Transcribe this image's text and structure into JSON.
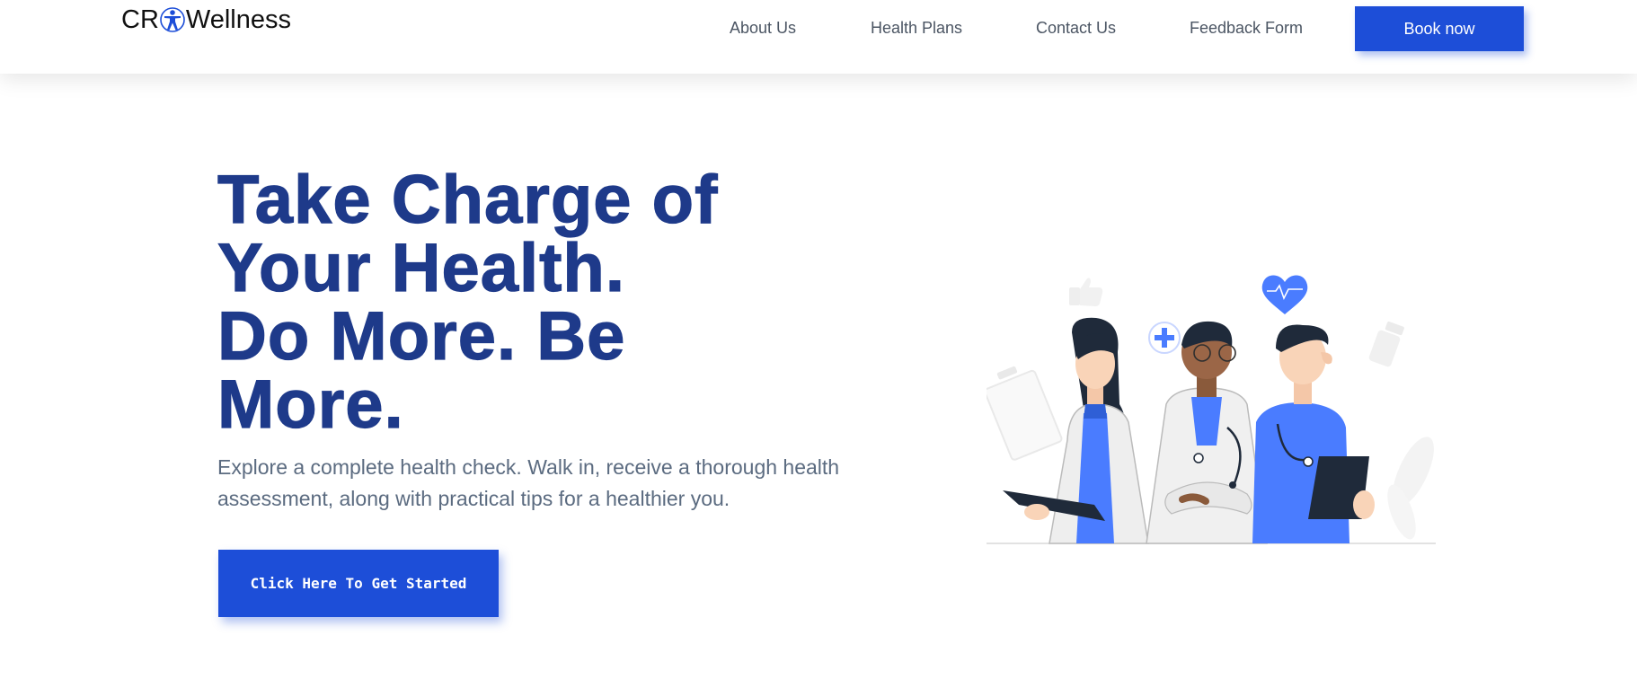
{
  "brand": {
    "prefix": "CR",
    "suffix": "Wellness",
    "icon": "accessibility-person-icon"
  },
  "nav": {
    "items": [
      {
        "label": "About Us"
      },
      {
        "label": "Health Plans"
      },
      {
        "label": "Contact Us"
      },
      {
        "label": "Feedback Form"
      }
    ],
    "cta_label": "Book now"
  },
  "hero": {
    "title_lines": [
      "Take Charge of",
      "Your Health.",
      "Do More. Be",
      "More."
    ],
    "subtitle": "Explore a complete health check. Walk in, receive a thorough health assessment, along with practical tips for a healthier you.",
    "cta_label": "Click Here To Get Started",
    "illustration": "medical-team-illustration"
  },
  "colors": {
    "accent": "#1d4ed8",
    "title": "#1e3a8a",
    "nav_text": "#4b5563",
    "body_text": "#5b6b80",
    "illustration_blue": "#4a7cff"
  }
}
